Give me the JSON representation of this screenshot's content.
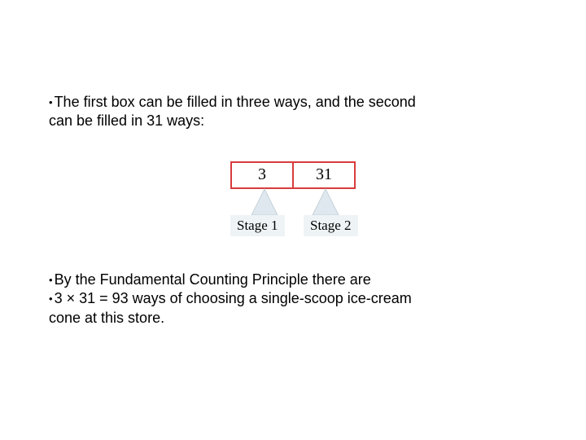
{
  "bullets": {
    "top1": "The first box can be filled in three ways, and the second",
    "top2": "can be filled in 31 ways:",
    "mid": "By the Fundamental Counting Principle there are",
    "bot1": "3 × 31 = 93 ways of choosing a single-scoop ice-cream",
    "bot2": "cone at this store."
  },
  "diagram": {
    "box1": "3",
    "box2": "31",
    "stage1": "Stage 1",
    "stage2": "Stage 2"
  }
}
